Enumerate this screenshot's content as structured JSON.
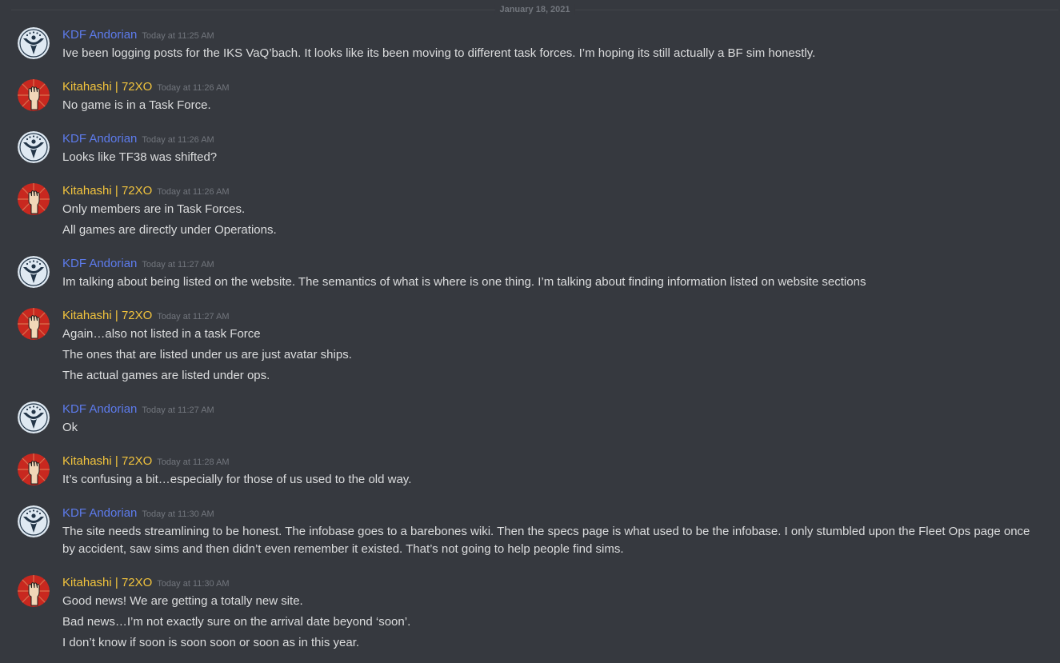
{
  "divider": {
    "date": "January 18, 2021"
  },
  "users": {
    "kdf": {
      "name": "KDF Andorian",
      "color": "#5d7bec",
      "avatar_icon": "andorian-emblem-icon"
    },
    "kit": {
      "name": "Kitahashi | 72XO",
      "color": "#f1c33d",
      "avatar_icon": "raised-fist-icon"
    }
  },
  "messages": [
    {
      "author": "KDF Andorian",
      "time": "Today at 11:25 AM",
      "lines": [
        "Ive been logging posts for the IKS VaQ’bach. It looks like its been moving to different task forces. I’m hoping its still actually a BF sim honestly."
      ]
    },
    {
      "author": "Kitahashi | 72XO",
      "time": "Today at 11:26 AM",
      "lines": [
        "No game is in a Task Force."
      ]
    },
    {
      "author": "KDF Andorian",
      "time": "Today at 11:26 AM",
      "lines": [
        "Looks like TF38 was shifted?"
      ]
    },
    {
      "author": "Kitahashi | 72XO",
      "time": "Today at 11:26 AM",
      "lines": [
        "Only members are in Task Forces.",
        "All games are directly under Operations."
      ]
    },
    {
      "author": "KDF Andorian",
      "time": "Today at 11:27 AM",
      "lines": [
        "Im talking about being listed on the website. The semantics of what is where is one thing. I’m talking about finding information listed on website sections"
      ]
    },
    {
      "author": "Kitahashi | 72XO",
      "time": "Today at 11:27 AM",
      "lines": [
        "Again…also not listed in a task Force",
        "The ones that are listed under us are just avatar ships.",
        "The actual games are listed under ops."
      ]
    },
    {
      "author": "KDF Andorian",
      "time": "Today at 11:27 AM",
      "lines": [
        "Ok"
      ]
    },
    {
      "author": "Kitahashi | 72XO",
      "time": "Today at 11:28 AM",
      "lines": [
        "It’s confusing a bit…especially for those of us used to the old way."
      ]
    },
    {
      "author": "KDF Andorian",
      "time": "Today at 11:30 AM",
      "lines": [
        "The site needs streamlining to be honest. The infobase goes to a barebones wiki. Then the specs page is what used to be the infobase. I only stumbled upon the Fleet Ops page once by accident, saw sims and then didn’t even remember it existed. That’s not going to help people find sims."
      ]
    },
    {
      "author": "Kitahashi | 72XO",
      "time": "Today at 11:30 AM",
      "lines": [
        "Good news! We are getting a totally new site.",
        "Bad news…I’m not exactly sure on the arrival date beyond ‘soon’.",
        "I don’t know if soon is soon soon or soon as in this year."
      ]
    }
  ]
}
